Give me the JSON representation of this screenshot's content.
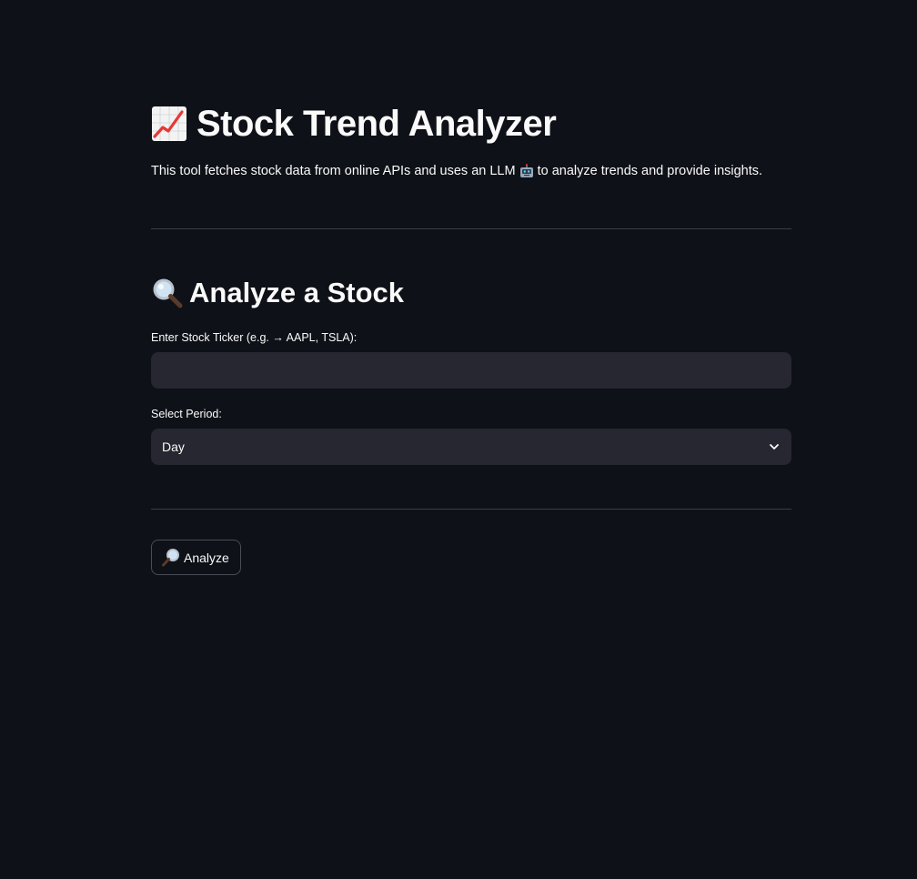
{
  "header": {
    "title_icon": "chart-increasing-icon",
    "title": "Stock Trend Analyzer",
    "intro_before": "This tool fetches stock data from online APIs and uses an LLM",
    "intro_icon": "robot-icon",
    "intro_after": "to analyze trends and provide insights."
  },
  "analyze_section": {
    "icon": "magnifying-glass-icon",
    "subheader": "Analyze a Stock",
    "ticker_label": "Enter Stock Ticker (e.g. → AAPL, TSLA):",
    "ticker_value": "",
    "ticker_placeholder": "",
    "period_label": "Select Period:",
    "period_value": "Day",
    "period_icon": "chevron-down-icon"
  },
  "actions": {
    "analyze_icon": "magnifying-glass-tilted-icon",
    "analyze_label": "Analyze"
  },
  "colors": {
    "background": "#0e1117",
    "input_background": "#262730",
    "text": "#fafafa",
    "divider": "#3a3d45"
  }
}
